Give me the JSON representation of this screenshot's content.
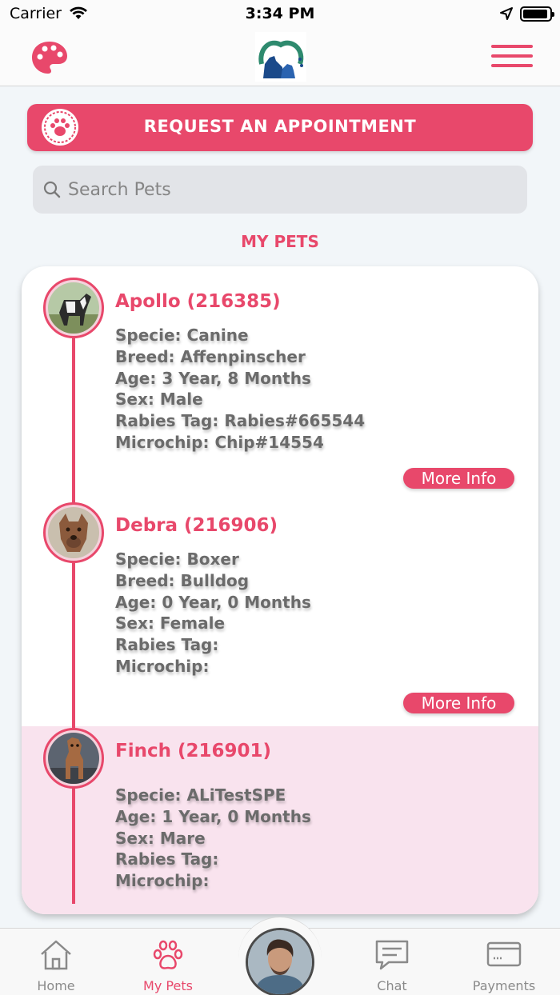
{
  "status_bar": {
    "carrier": "Carrier",
    "time": "3:34 PM"
  },
  "header": {
    "palette_icon": "palette-icon",
    "logo_icon": "clinic-logo",
    "menu_icon": "hamburger-menu-icon"
  },
  "request_button": {
    "label": "REQUEST AN APPOINTMENT",
    "icon": "paw-icon"
  },
  "search": {
    "placeholder": "Search Pets",
    "value": ""
  },
  "section_title": "MY PETS",
  "pets": [
    {
      "name": "Apollo (216385)",
      "lines": [
        "Specie: Canine",
        "Breed: Affenpinscher",
        "Age: 3 Year, 8 Months",
        "Sex: Male",
        "Rabies Tag: Rabies#665544",
        "Microchip: Chip#14554"
      ],
      "more": "More Info"
    },
    {
      "name": "Debra (216906)",
      "lines": [
        "Specie: Boxer",
        "Breed: Bulldog",
        "Age: 0 Year, 0 Months",
        "Sex: Female",
        "Rabies Tag:",
        "Microchip:"
      ],
      "more": "More Info"
    },
    {
      "name": "Finch (216901)",
      "lines": [
        "Specie: ALiTestSPE",
        "Age: 1 Year, 0 Months",
        "Sex: Mare",
        "Rabies Tag:",
        "Microchip:"
      ]
    }
  ],
  "tabs": [
    {
      "label": "Home",
      "icon": "home-icon"
    },
    {
      "label": "My Pets",
      "icon": "paw-icon"
    },
    {
      "label": "Chat",
      "icon": "chat-icon"
    },
    {
      "label": "Payments",
      "icon": "credit-card-icon"
    }
  ],
  "colors": {
    "accent": "#e8486b",
    "selected_row": "#f9e3ee",
    "text_gray": "#6b6b6b",
    "background": "#f2f6f9"
  }
}
